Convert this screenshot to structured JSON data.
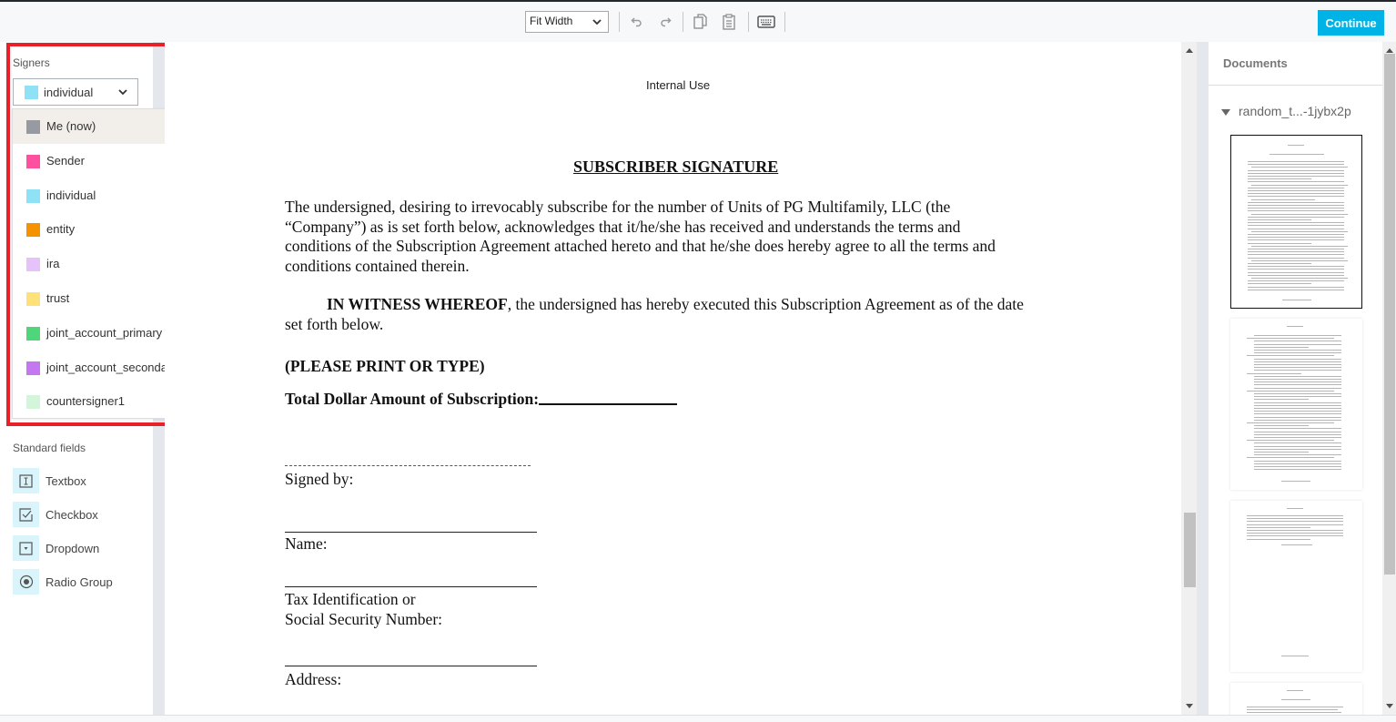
{
  "toolbar": {
    "zoom_value": "Fit Width",
    "undo_icon": "undo-icon",
    "redo_icon": "redo-icon",
    "copy_icon": "copy-icon",
    "paste_icon": "clipboard-icon",
    "keyboard_icon": "keyboard-icon",
    "continue_label": "Continue"
  },
  "colors": {
    "accent": "#00b3e6",
    "highlight_border": "#e8202a"
  },
  "left_panel": {
    "signers_heading": "Signers",
    "selected_signer": {
      "label": "individual",
      "color": "#8fe1f5"
    },
    "signer_options": [
      {
        "label": "Me (now)",
        "color": "#979aa0",
        "active": true
      },
      {
        "label": "Sender",
        "color": "#ff4f9f",
        "active": false
      },
      {
        "label": "individual",
        "color": "#8fe1f5",
        "active": false
      },
      {
        "label": "entity",
        "color": "#f59200",
        "active": false
      },
      {
        "label": "ira",
        "color": "#e6c2fb",
        "active": false
      },
      {
        "label": "trust",
        "color": "#ffe17a",
        "active": false
      },
      {
        "label": "joint_account_primary",
        "color": "#4fd67a",
        "active": false
      },
      {
        "label": "joint_account_secondary",
        "color": "#c477f0",
        "active": false
      },
      {
        "label": "countersigner1",
        "color": "#d3f6db",
        "active": false
      }
    ],
    "standard_fields_heading": "Standard fields",
    "standard_fields": [
      {
        "label": "Textbox",
        "icon": "textbox-icon"
      },
      {
        "label": "Checkbox",
        "icon": "checkbox-icon"
      },
      {
        "label": "Dropdown",
        "icon": "dropdown-icon"
      },
      {
        "label": "Radio Group",
        "icon": "radio-icon"
      }
    ]
  },
  "document": {
    "header_label": "Internal Use",
    "title": "SUBSCRIBER SIGNATURE",
    "paragraph1_lines": [
      "The undersigned, desiring to irrevocably subscribe for the number of Units of PG Multifamily, LLC (the",
      "“Company”) as is set forth below, acknowledges that it/he/she has received and understands the terms and",
      "conditions of the Subscription Agreement attached hereto and that he/she does hereby agree to all the terms and",
      "conditions contained therein."
    ],
    "witness_bold": "IN WITNESS WHEREOF",
    "witness_rest_line1": ", the undersigned has hereby executed this Subscription Agreement as of the date",
    "witness_line2": "set forth below.",
    "print_notice": "(PLEASE PRINT OR TYPE)",
    "total_amount_label": "Total Dollar Amount of Subscription:",
    "signed_by_label": "Signed by:",
    "name_label": "Name:",
    "tax_id_label_line1": "Tax Identification or",
    "tax_id_label_line2": "Social Security Number:",
    "address_label": "Address:"
  },
  "documents_panel": {
    "title": "Documents",
    "file_name": "random_t...-1jybx2p",
    "page_count_visible": 4
  }
}
